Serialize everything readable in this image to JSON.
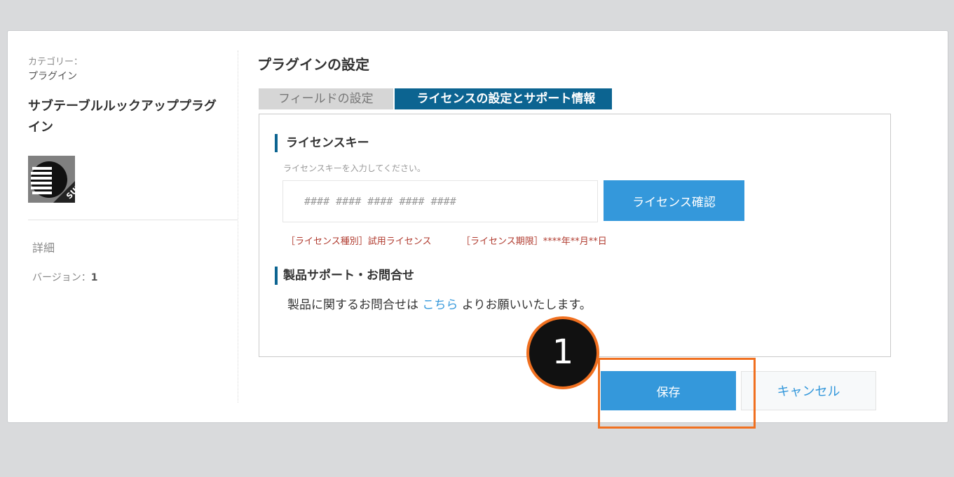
{
  "sidebar": {
    "category_label": "カテゴリー：",
    "category_value": "プラグイン",
    "plugin_name": "サブテーブルルックアッププラグイン",
    "plugin_icon_name": "subtable-plugin-icon",
    "plugin_icon_badge": "SUB",
    "detail_label": "詳細",
    "version_label": "バージョン：",
    "version_value": "1"
  },
  "main": {
    "title": "プラグインの設定",
    "tabs": [
      {
        "label": "フィールドの設定",
        "active": false
      },
      {
        "label": "ライセンスの設定とサポート情報",
        "active": true
      }
    ],
    "license": {
      "heading": "ライセンスキー",
      "hint": "ライセンスキーを入力してください。",
      "input_placeholder": "#### #### #### #### ####",
      "input_value": "",
      "confirm_button": "ライセンス確認",
      "license_type": "［ライセンス種別］試用ライセンス",
      "license_expiry": "［ライセンス期限］****年**月**日"
    },
    "support": {
      "heading": "製品サポート・お問合せ",
      "text_before": "製品に関するお問合せは",
      "link_text": "こちら",
      "text_after": "よりお願いいたします。"
    }
  },
  "footer": {
    "save_button": "保存",
    "cancel_button": "キャンセル"
  },
  "annotation": {
    "step_number": "1",
    "highlight_color": "#f07020"
  },
  "colors": {
    "accent_blue": "#3498db",
    "tab_active": "#0c6491",
    "license_info": "#b03a2e"
  }
}
